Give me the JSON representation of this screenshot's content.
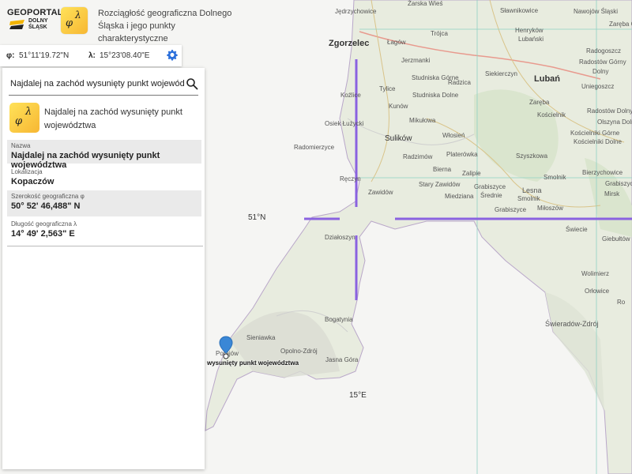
{
  "header": {
    "logo_line1": "GEOPORTAL",
    "logo_line2": "DOLNY",
    "logo_line3": "ŚLĄSK",
    "app_icon_phi": "φ",
    "app_icon_lambda": "λ",
    "app_title": "Rozciągłość geograficzna Dolnego Śląska i jego punkty charakterystyczne"
  },
  "coords": {
    "phi_label": "φ:",
    "phi_value": "51°11'19.72\"N",
    "lambda_label": "λ:",
    "lambda_value": "15°23'08.40\"E",
    "settings_icon": "gear-icon"
  },
  "search": {
    "value": "Najdalej na zachód wysunięty punkt województwa",
    "icon": "search-icon"
  },
  "result": {
    "title": "Najdalej na zachód wysunięty punkt województwa",
    "fields": [
      {
        "key": "Nazwa",
        "value": "Najdalej na zachód wysunięty punkt województwa"
      },
      {
        "key": "Lokalizacja",
        "value": "Kopaczów"
      },
      {
        "key": "Szerokość geograficzna φ",
        "value": "50° 52' 46,488\" N"
      },
      {
        "key": "Długość geograficzna λ",
        "value": "14° 49' 2,563\" E"
      }
    ]
  },
  "map": {
    "grid_labels": [
      "51°N",
      "15°E"
    ],
    "towns": [
      "Zgorzelec",
      "Lubań"
    ],
    "places": [
      "Jędrzychowice",
      "Żarska Wieś",
      "Sławnikowice",
      "Nawojów Śląski",
      "Zaręba Górna",
      "Trójca",
      "Henryków",
      "Radogoszcz",
      "Łagów",
      "Lubański",
      "Jerzmanki",
      "Siekierczyn",
      "Radostów Górny",
      "Studniska Górne",
      "Radzica",
      "Dolny",
      "Tylice",
      "Studniska Dolne",
      "Uniegoszcz",
      "Koźlice",
      "Zaręba",
      "Radostów Dolny",
      "Kunów",
      "Mikułowa",
      "Kościelnik",
      "Olszyna Dolna",
      "Osiek Łużycki",
      "Kościelniki Górne",
      "Sulików",
      "Kościelniki Dolne",
      "Radomierzyce",
      "Platerówka",
      "Włosień",
      "Radzimów",
      "Szyszkowa",
      "Biernа",
      "Zalipie",
      "Smolnik",
      "Bierzychowice",
      "Ręczyn",
      "Stary Zawidów",
      "Grabiszyce",
      "Zawidów",
      "Miedziana",
      "Średnie",
      "Lesna",
      "Grabiszyce Górne",
      "Smolnik",
      "Mirsk",
      "Grabiszyce",
      "Miłoszów",
      "Działoszyn",
      "Świecie",
      "Giebułtów",
      "Bogatynia",
      "Sieniawka",
      "Opolno-Zdrój",
      "Jasna Góra",
      "Porajów",
      "Wolimierz",
      "Orłowice",
      "Świeradów-Zdrój",
      "Ro"
    ],
    "marker_label": "wysunięty punkt województwa"
  }
}
